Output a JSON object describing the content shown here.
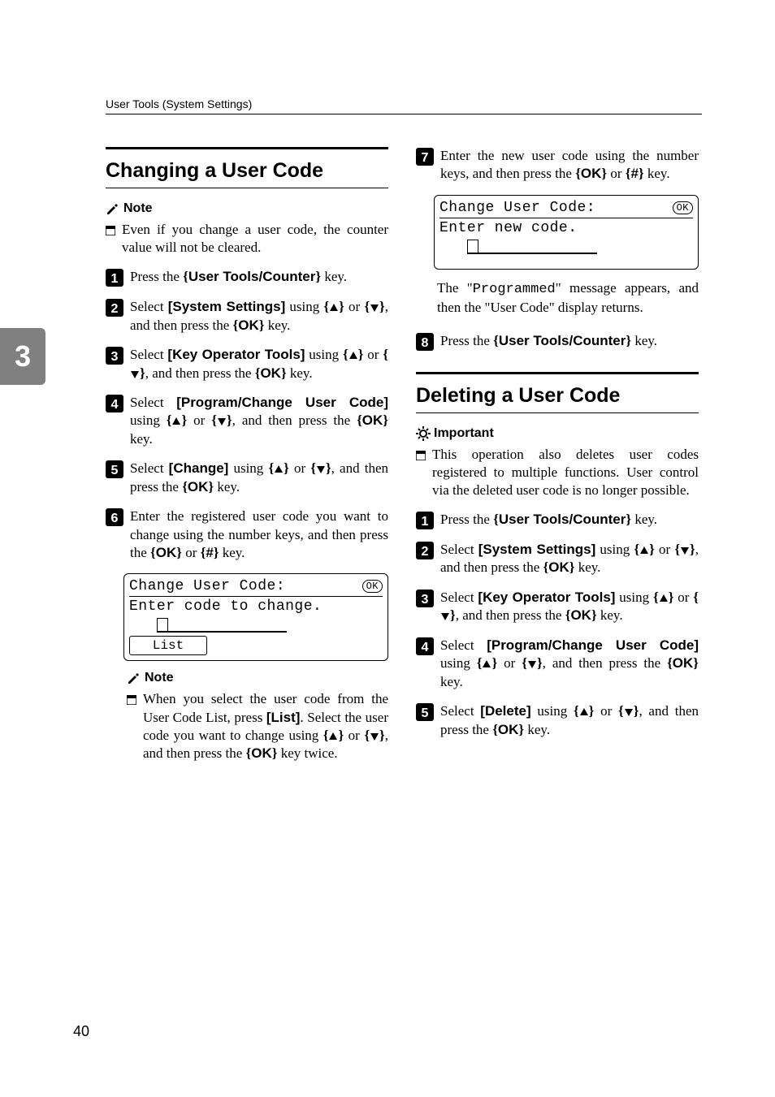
{
  "runningHead": "User Tools (System Settings)",
  "sideTab": "3",
  "pageNumber": "40",
  "left": {
    "sectionTitle": "Changing a User Code",
    "noteLabel": "Note",
    "notePara": "Even if you change a user code, the counter value will not be cleared.",
    "steps": {
      "s1_a": "Press the ",
      "s1_key": "User Tools/Counter",
      "s1_b": " key.",
      "s2_a": "Select ",
      "s2_ui": "[System Settings]",
      "s2_b": " using ",
      "s2_c": " or ",
      "s2_d": ", and then press the ",
      "s2_key": "OK",
      "s2_e": " key.",
      "s3_a": "Select ",
      "s3_ui": "[Key Operator Tools]",
      "s3_b": " using ",
      "s3_c": " or ",
      "s3_d": ", and then press the ",
      "s3_key": "OK",
      "s3_e": " key.",
      "s4_a": "Select ",
      "s4_ui": "[Program/Change User Code]",
      "s4_b": " using ",
      "s4_c": " or ",
      "s4_d": ", and then press the ",
      "s4_key": "OK",
      "s4_e": " key.",
      "s5_a": "Select ",
      "s5_ui": "[Change]",
      "s5_b": " using ",
      "s5_c": " or ",
      "s5_d": ", and then press the ",
      "s5_key": "OK",
      "s5_e": " key.",
      "s6_a": "Enter the registered user code you want to change using the number keys, and then press the ",
      "s6_key1": "OK",
      "s6_b": " or ",
      "s6_key2": "#",
      "s6_c": " key."
    },
    "screen1": {
      "title": "Change User Code:",
      "ok": "OK",
      "line2": "Enter code to change.",
      "soft1": "List"
    },
    "subNoteLabel": "Note",
    "subNote_a": "When you select the user code from the User Code List, press ",
    "subNote_ui": "[List]",
    "subNote_b": ". Select the user code you want to change using ",
    "subNote_c": " or ",
    "subNote_d": ", and then press the ",
    "subNote_key": "OK",
    "subNote_e": " key twice."
  },
  "right": {
    "step7_a": "Enter the new user code using the number keys, and then press the ",
    "step7_key1": "OK",
    "step7_b": " or ",
    "step7_key2": "#",
    "step7_c": " key.",
    "screen2": {
      "title": "Change User Code:",
      "ok": "OK",
      "line2": "Enter new code."
    },
    "after_a": "The \"",
    "after_mono": "Programmed",
    "after_b": "\" message appears, and then the \"User Code\" display returns.",
    "step8_a": "Press the ",
    "step8_key": "User Tools/Counter",
    "step8_b": " key.",
    "section2Title": "Deleting a User Code",
    "importantLabel": "Important",
    "importantPara": "This operation also deletes user codes registered to multiple functions. User control via the deleted user code is no longer possible.",
    "d1_a": "Press the ",
    "d1_key": "User Tools/Counter",
    "d1_b": " key.",
    "d2_a": "Select ",
    "d2_ui": "[System Settings]",
    "d2_b": " using ",
    "d2_c": " or ",
    "d2_d": ", and then press the ",
    "d2_key": "OK",
    "d2_e": " key.",
    "d3_a": "Select ",
    "d3_ui": "[Key Operator Tools]",
    "d3_b": " using ",
    "d3_c": " or ",
    "d3_d": ", and then press the ",
    "d3_key": "OK",
    "d3_e": " key.",
    "d4_a": "Select ",
    "d4_ui": "[Program/Change User Code]",
    "d4_b": " using ",
    "d4_c": " or ",
    "d4_d": ", and then press the ",
    "d4_key": "OK",
    "d4_e": " key.",
    "d5_a": "Select ",
    "d5_ui": "[Delete]",
    "d5_b": " using ",
    "d5_c": " or ",
    "d5_d": ", and then press the ",
    "d5_key": "OK",
    "d5_e": " key."
  }
}
